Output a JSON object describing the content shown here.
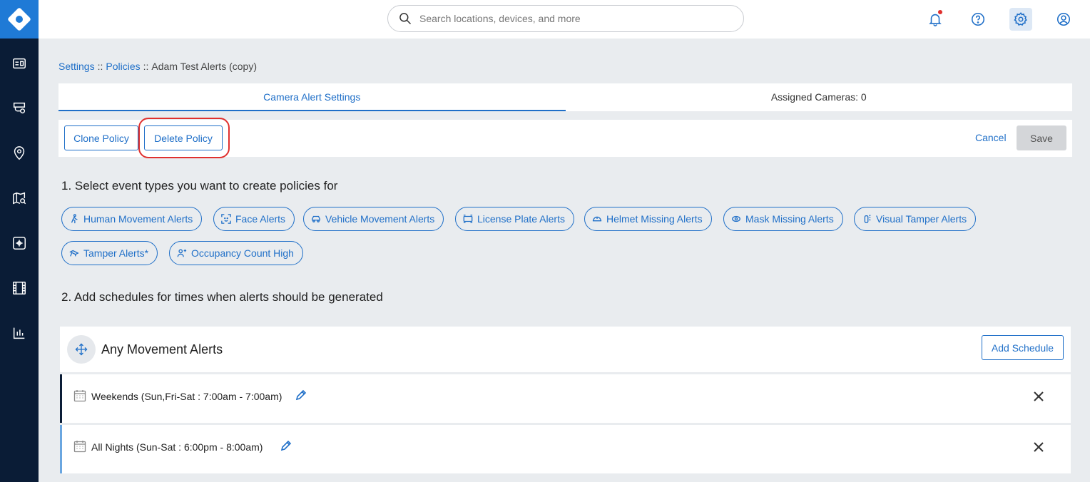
{
  "search": {
    "placeholder": "Search locations, devices, and more"
  },
  "breadcrumb": {
    "settings": "Settings",
    "policies": "Policies",
    "sep": "::",
    "current": "Adam Test Alerts (copy)"
  },
  "tabs": [
    {
      "label": "Camera Alert Settings",
      "active": true
    },
    {
      "label": "Assigned Cameras: 0",
      "active": false
    }
  ],
  "actions": {
    "clone": "Clone Policy",
    "delete": "Delete Policy",
    "cancel": "Cancel",
    "save": "Save"
  },
  "section1": {
    "title": "1. Select event types you want to create policies for"
  },
  "event_types": [
    {
      "label": "Human Movement Alerts",
      "icon": "person-walking-icon"
    },
    {
      "label": "Face Alerts",
      "icon": "face-scan-icon"
    },
    {
      "label": "Vehicle Movement Alerts",
      "icon": "car-icon"
    },
    {
      "label": "License Plate Alerts",
      "icon": "license-plate-icon"
    },
    {
      "label": "Helmet Missing Alerts",
      "icon": "helmet-icon"
    },
    {
      "label": "Mask Missing Alerts",
      "icon": "mask-icon"
    },
    {
      "label": "Visual Tamper Alerts",
      "icon": "camera-tamper-icon"
    },
    {
      "label": "Tamper Alerts*",
      "icon": "tamper-icon"
    },
    {
      "label": "Occupancy Count High",
      "icon": "person-plus-icon"
    }
  ],
  "section2": {
    "title": "2. Add schedules for times when alerts should be generated"
  },
  "schedule_group": {
    "title": "Any Movement Alerts",
    "add_label": "Add Schedule"
  },
  "schedules": [
    {
      "label": "Weekends (Sun,Fri-Sat : 7:00am - 7:00am)"
    },
    {
      "label": "All Nights (Sun-Sat : 6:00pm - 8:00am)"
    }
  ],
  "colors": {
    "accent": "#1f6fc8",
    "sidebar": "#0a1c36",
    "logo": "#1f7ad6",
    "highlight": "#e0302e"
  }
}
